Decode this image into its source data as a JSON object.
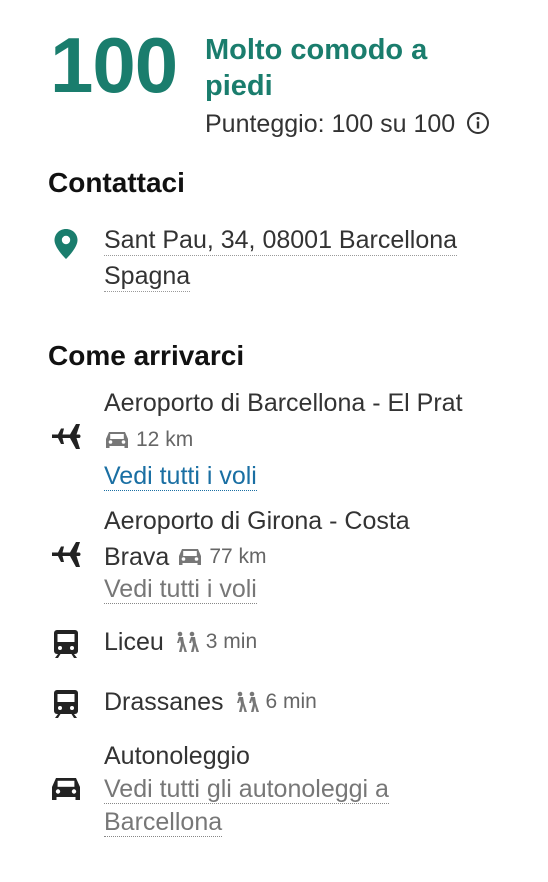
{
  "score": {
    "value": "100",
    "title": "Molto comodo a piedi",
    "subtitle": "Punteggio: 100 su 100"
  },
  "contact": {
    "heading": "Contattaci",
    "address_line1": "Sant Pau, 34, 08001 Barcellona",
    "address_line2": "Spagna"
  },
  "directions": {
    "heading": "Come arrivarci",
    "airport1": {
      "name": "Aeroporto di Barcellona - El Prat",
      "distance": "12 km",
      "link": "Vedi tutti i voli"
    },
    "airport2": {
      "name_line1": "Aeroporto di Girona - Costa",
      "name_line2": "Brava",
      "distance": "77 km",
      "link": "Vedi tutti i voli"
    },
    "metro1": {
      "name": "Liceu",
      "walk": "3 min"
    },
    "metro2": {
      "name": "Drassanes",
      "walk": "6 min"
    },
    "car_rental": {
      "name": "Autonoleggio",
      "link_line1": "Vedi tutti gli autonoleggi a",
      "link_line2": "Barcellona"
    }
  },
  "icons": {
    "info": "info-icon",
    "location": "location-pin-icon",
    "plane": "plane-icon",
    "car": "car-icon",
    "train": "train-icon",
    "walk": "walking-icon"
  },
  "colors": {
    "accent": "#1a7d6d",
    "link": "#1a6fa3",
    "muted": "#777777"
  }
}
